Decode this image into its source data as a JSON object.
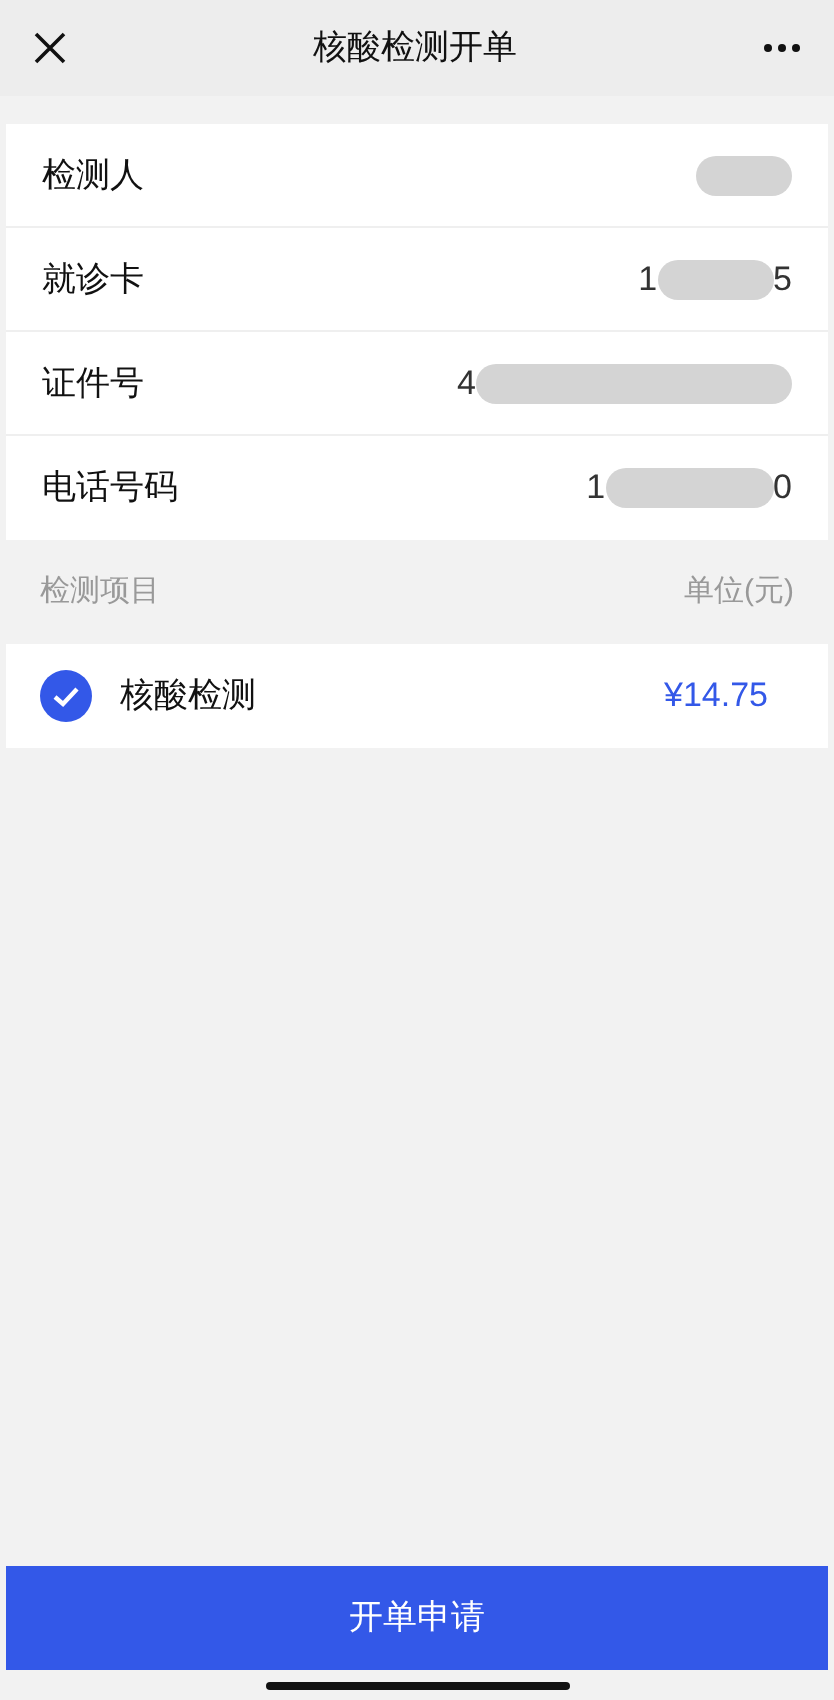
{
  "nav": {
    "title": "核酸检测开单"
  },
  "info_rows": [
    {
      "label": "检测人",
      "value_start": "",
      "value_end": ""
    },
    {
      "label": "就诊卡",
      "value_start": "1",
      "value_end": "5"
    },
    {
      "label": "证件号",
      "value_start": "4",
      "value_end": ""
    },
    {
      "label": "电话号码",
      "value_start": "1",
      "value_end": "0"
    }
  ],
  "items_header": {
    "left": "检测项目",
    "right": "单位(元)"
  },
  "items": [
    {
      "name": "核酸检测",
      "price": "¥14.75",
      "checked": true
    }
  ],
  "submit_button": "开单申请"
}
